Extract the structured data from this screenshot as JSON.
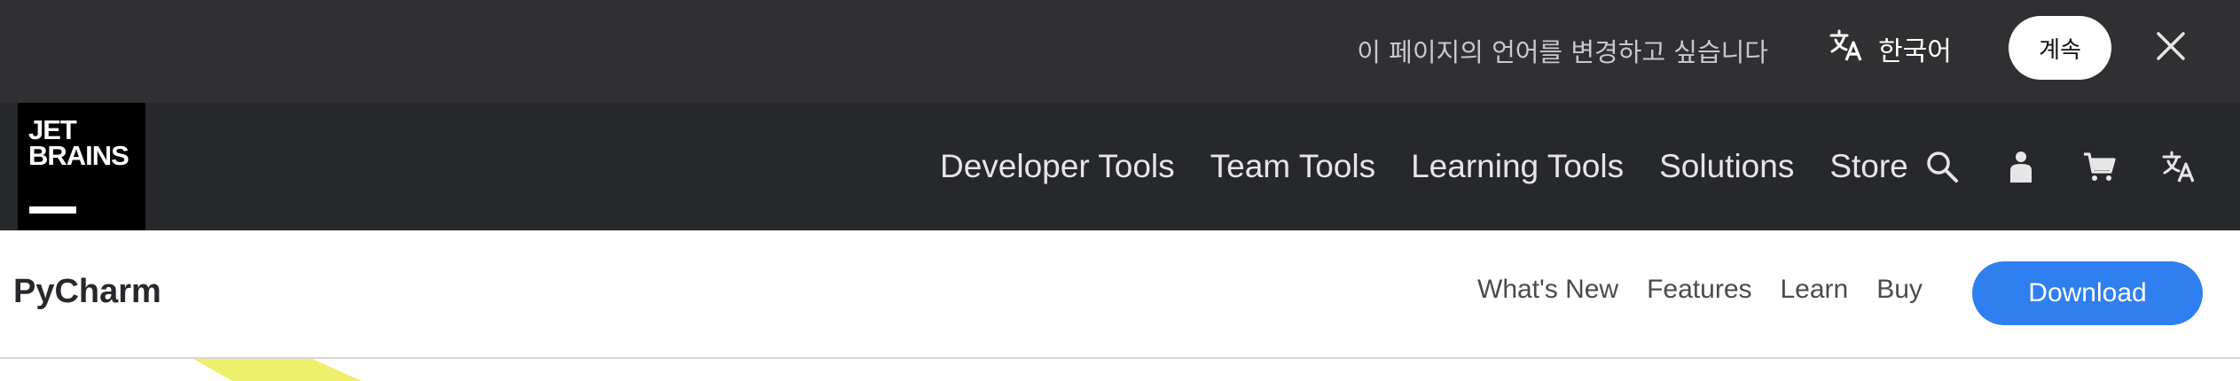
{
  "language_banner": {
    "message": "이 페이지의 언어를 변경하고 싶습니다",
    "language_label": "한국어",
    "continue_label": "계속",
    "icons": {
      "translate": "translate-icon",
      "close": "close-icon"
    }
  },
  "main_nav": {
    "logo_text": "JET\nBRAINS",
    "links": [
      {
        "label": "Developer Tools"
      },
      {
        "label": "Team Tools"
      },
      {
        "label": "Learning Tools"
      },
      {
        "label": "Solutions"
      },
      {
        "label": "Store"
      }
    ],
    "icons": [
      "search-icon",
      "user-icon",
      "cart-icon",
      "translate-icon"
    ]
  },
  "product_bar": {
    "name": "PyCharm",
    "links": [
      {
        "label": "What's New"
      },
      {
        "label": "Features"
      },
      {
        "label": "Learn"
      },
      {
        "label": "Buy"
      }
    ],
    "download_label": "Download"
  },
  "colors": {
    "banner_bg": "#303033",
    "nav_bg": "#27282c",
    "download_blue": "#307ff0",
    "decor_yellow": "#eef06a"
  }
}
